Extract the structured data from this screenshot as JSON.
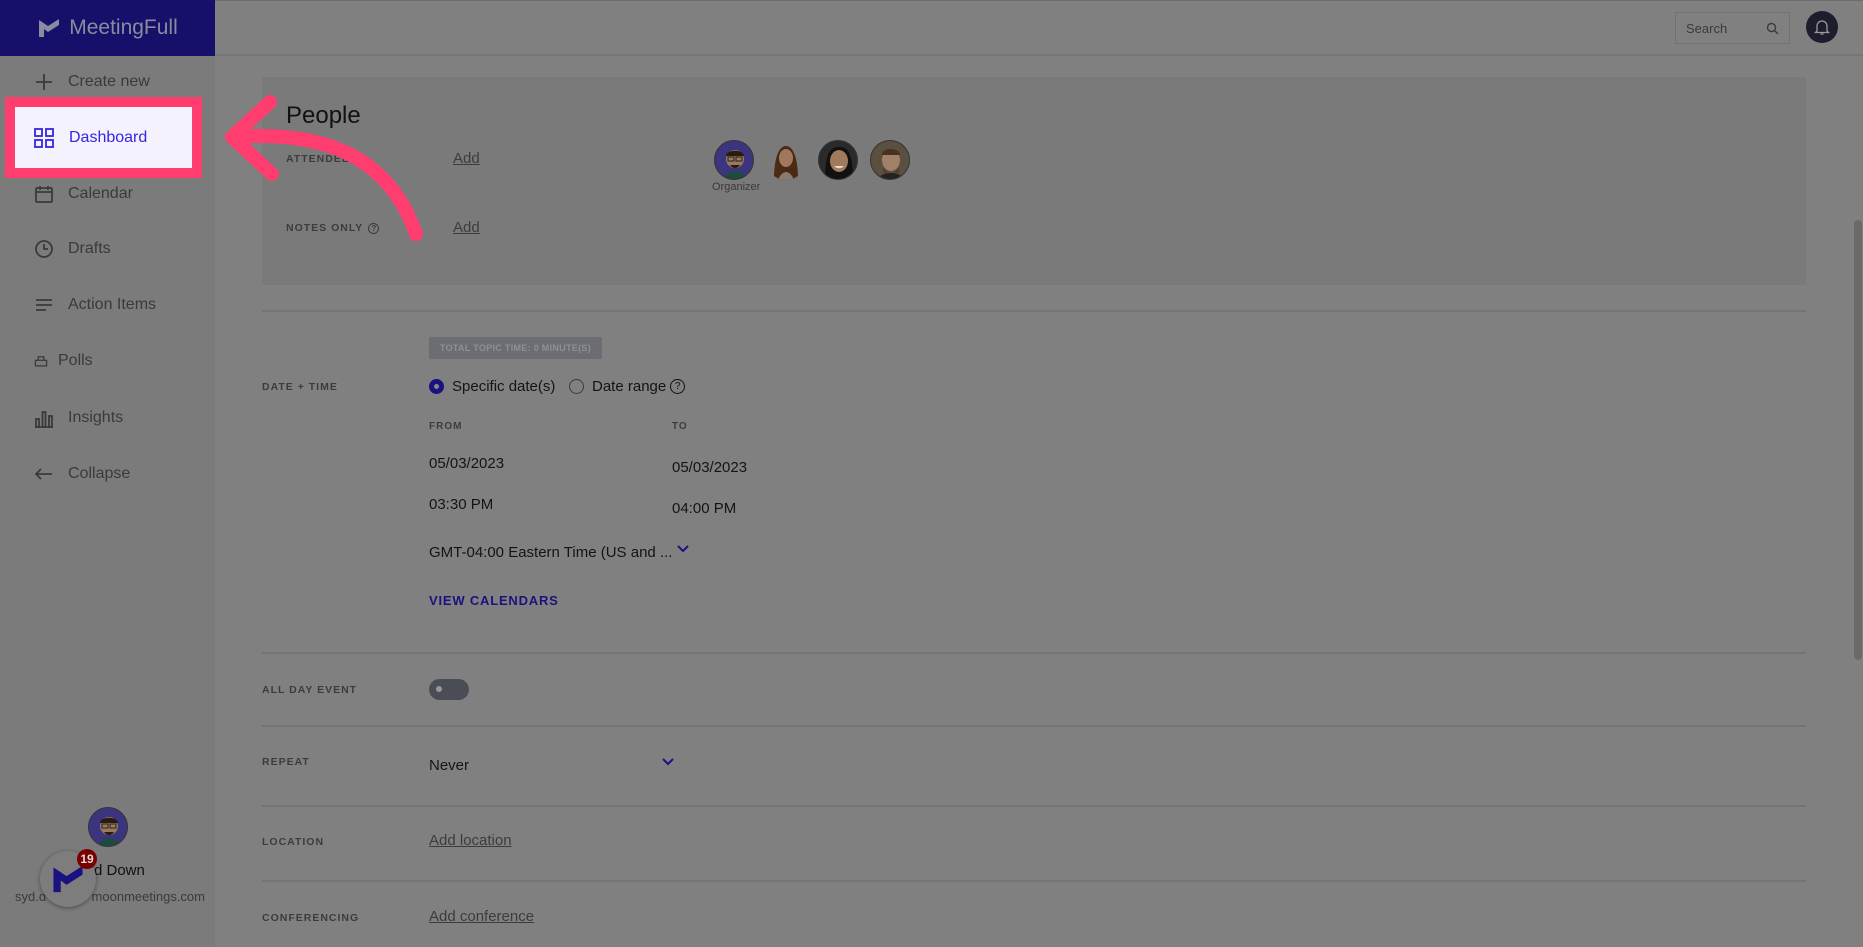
{
  "app": {
    "name": "MeetingFull",
    "accent_color": "#3526e0",
    "highlight_color": "#ff3d6e"
  },
  "sidebar": {
    "items": [
      {
        "label": "Create new",
        "icon": "plus-icon"
      },
      {
        "label": "Dashboard",
        "icon": "grid-icon",
        "highlighted": true
      },
      {
        "label": "Calendar",
        "icon": "calendar-icon"
      },
      {
        "label": "Drafts",
        "icon": "clock-icon"
      },
      {
        "label": "Action Items",
        "icon": "list-icon"
      },
      {
        "label": "Polls",
        "icon": "ballot-icon"
      },
      {
        "label": "Insights",
        "icon": "bar-chart-icon"
      },
      {
        "label": "Collapse",
        "icon": "arrow-left-icon"
      }
    ],
    "user": {
      "name_visible": "d Down",
      "email_start": "syd.d",
      "email_end": "moonmeetings.com"
    },
    "widget_badge": "19"
  },
  "header": {
    "search_placeholder": "Search"
  },
  "people": {
    "title": "People",
    "attendees_label": "ATTENDEES",
    "attendees_add": "Add",
    "notes_only_label": "NOTES ONLY",
    "notes_only_add": "Add",
    "organizer_label": "Organizer"
  },
  "datetime": {
    "badge": "TOTAL TOPIC TIME: 0 MINUTE(S)",
    "label": "DATE + TIME",
    "option_specific": "Specific date(s)",
    "option_range": "Date range",
    "selected": "Specific date(s)",
    "from_label": "FROM",
    "to_label": "TO",
    "from_date": "05/03/2023",
    "to_date": "05/03/2023",
    "from_time": "03:30 PM",
    "to_time": "04:00 PM",
    "timezone": "GMT-04:00 Eastern Time (US and ...",
    "view_calendars": "VIEW CALENDARS"
  },
  "all_day": {
    "label": "ALL DAY EVENT",
    "on": false
  },
  "repeat": {
    "label": "REPEAT",
    "value": "Never"
  },
  "location": {
    "label": "LOCATION",
    "link": "Add location"
  },
  "conferencing": {
    "label": "CONFERENCING",
    "link": "Add conference"
  }
}
